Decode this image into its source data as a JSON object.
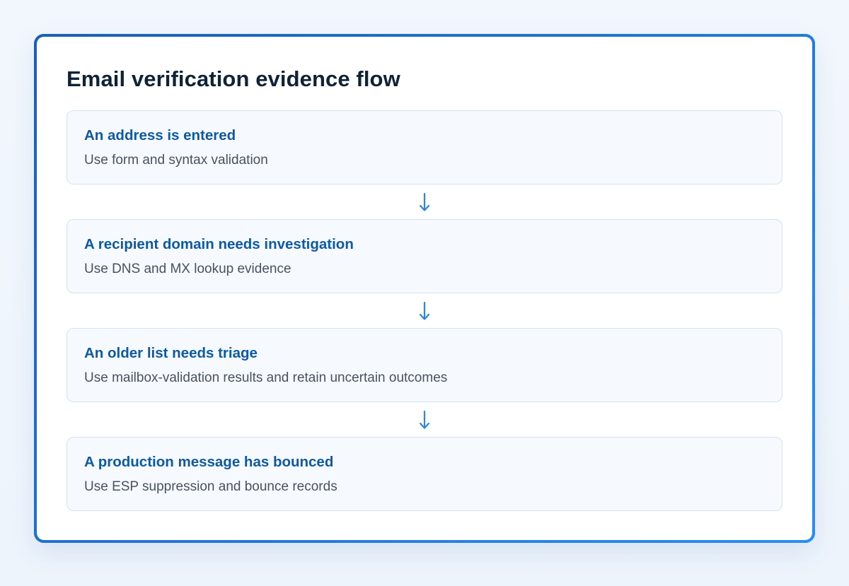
{
  "flow": {
    "title": "Email verification evidence flow",
    "steps": [
      {
        "title": "An address is entered",
        "description": "Use form and syntax validation"
      },
      {
        "title": "A recipient domain needs investigation",
        "description": "Use DNS and MX lookup evidence"
      },
      {
        "title": "An older list needs triage",
        "description": "Use mailbox-validation results and retain uncertain outcomes"
      },
      {
        "title": "A production message has bounced",
        "description": "Use ESP suppression and bounce records"
      }
    ],
    "connector_icon": "arrow-down-icon"
  },
  "colors": {
    "page_background": "#eef5fc",
    "card_border": "#1c6fd0",
    "title": "#0f2236",
    "step_title": "#0d5aa3",
    "step_description": "#47525e",
    "step_border": "#d2e2f3",
    "step_background": "#f6fafe",
    "arrow": "#2a86e0"
  }
}
